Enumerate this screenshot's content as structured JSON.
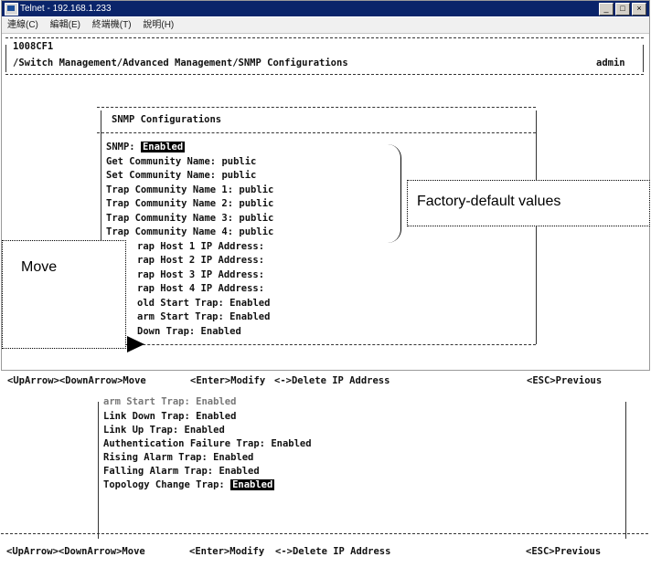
{
  "window": {
    "title": "Telnet - 192.168.1.233",
    "menu": [
      "連線(C)",
      "編輯(E)",
      "終端機(T)",
      "說明(H)"
    ],
    "buttons": [
      "_",
      "□",
      "×"
    ]
  },
  "header": {
    "device": "1008CF1",
    "path": "/Switch Management/Advanced Management/SNMP Configurations",
    "user": "admin"
  },
  "panel_title": "SNMP Configurations",
  "fields": [
    {
      "label": "SNMP: ",
      "value": "Enabled"
    },
    {
      "label": "Get Community Name: ",
      "value": "public"
    },
    {
      "label": "Set Community Name: ",
      "value": "public"
    },
    {
      "label": "Trap Community Name 1: ",
      "value": "public"
    },
    {
      "label": "Trap Community Name 2: ",
      "value": "public"
    },
    {
      "label": "Trap Community Name 3: ",
      "value": "public"
    },
    {
      "label": "Trap Community Name 4: ",
      "value": "public"
    },
    {
      "label": "rap Host 1 IP Address:",
      "value": ""
    },
    {
      "label": "rap Host 2 IP Address:",
      "value": ""
    },
    {
      "label": "rap Host 3 IP Address:",
      "value": ""
    },
    {
      "label": "rap Host 4 IP Address:",
      "value": ""
    },
    {
      "label": "old Start Trap: ",
      "value": "Enabled"
    },
    {
      "label": "arm Start Trap: ",
      "value": "Enabled"
    },
    {
      "label": "Down Trap: ",
      "value": "Enabled"
    }
  ],
  "footer": {
    "nav": "<UpArrow><DownArrow>Move",
    "modify": "<Enter>Modify",
    "delete": "<->Delete IP Address",
    "previous": "<ESC>Previous"
  },
  "callouts": {
    "defaults": "Factory-default values",
    "move": "Move"
  },
  "fragment": {
    "partial_line": "arm Start Trap: Enabled",
    "fields": [
      {
        "label": "Link Down Trap: ",
        "value": "Enabled"
      },
      {
        "label": "Link Up Trap: ",
        "value": "Enabled"
      },
      {
        "label": "Authentication Failure Trap: ",
        "value": "Enabled"
      },
      {
        "label": "Rising Alarm Trap: ",
        "value": "Enabled"
      },
      {
        "label": "Falling Alarm Trap: ",
        "value": "Enabled"
      },
      {
        "label": "Topology Change Trap: ",
        "value": "Enabled"
      }
    ]
  }
}
